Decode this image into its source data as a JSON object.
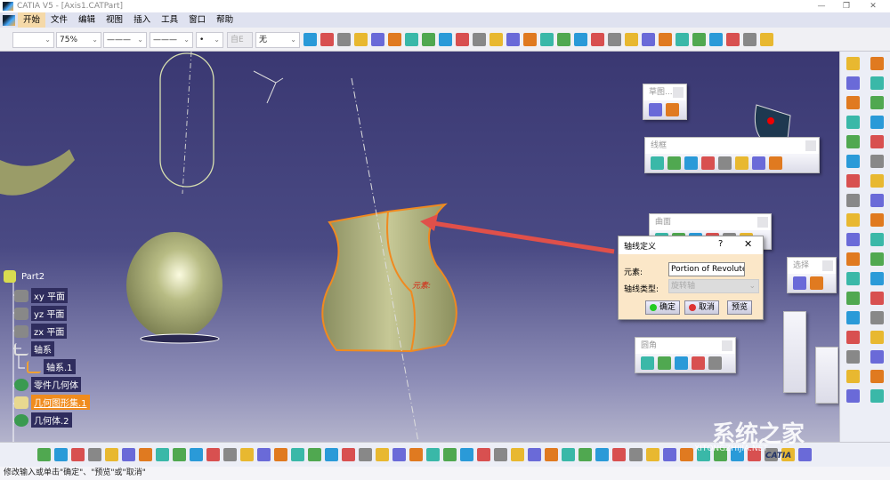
{
  "window": {
    "title": "CATIA V5 - [Axis1.CATPart]",
    "min": "—",
    "max": "❐",
    "close": "✕"
  },
  "menu": [
    "开始",
    "文件",
    "编辑",
    "视图",
    "插入",
    "工具",
    "窗口",
    "帮助"
  ],
  "toolbar": {
    "color": "",
    "transparency": "75%",
    "linetype": "———",
    "linewidth": "———",
    "point": "•",
    "layer": "自E",
    "style": "无"
  },
  "tree": {
    "root": "Part2",
    "items": [
      "xy 平面",
      "yz 平面",
      "zx 平面",
      "轴系",
      "轴系.1",
      "零件几何体",
      "几何图形集.1",
      "几何体.2"
    ]
  },
  "floating": {
    "sketch": "草图...",
    "wireframe": "线框",
    "surface": "曲面",
    "select": "选择",
    "fillet": "圆角"
  },
  "dialog": {
    "title": "轴线定义",
    "help": "?",
    "close": "✕",
    "element_label": "元素:",
    "element_value": "Portion of Revolute",
    "axis_type_label": "轴线类型:",
    "axis_type_value": "旋转轴",
    "ok": "确定",
    "cancel": "取消",
    "preview": "预览"
  },
  "viewport": {
    "annotation": "元素:"
  },
  "status": "修改输入或单击\"确定\"、\"预览\"或\"取消\"",
  "watermark": {
    "brand": "系统之家",
    "url": "XITONGZHIJIA.NET",
    "catia": "CATIA"
  },
  "icon_colors": [
    "#2a9ad8",
    "#e8b830",
    "#3ab8a8",
    "#d85050",
    "#6a6ad8",
    "#50a850",
    "#888",
    "#e07a20"
  ]
}
